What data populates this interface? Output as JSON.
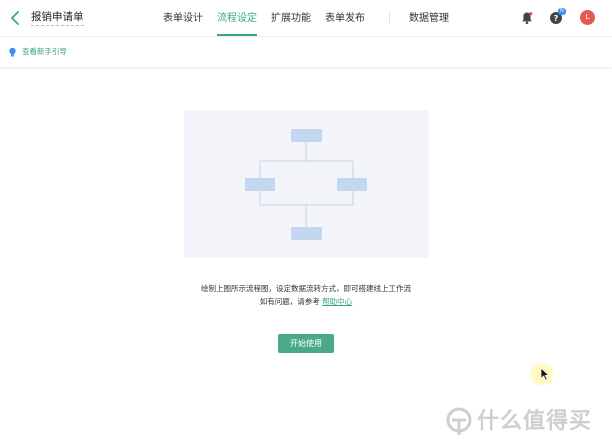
{
  "header": {
    "form_title": "报销申请单",
    "nav_tabs": [
      "表单设计",
      "流程设定",
      "扩展功能",
      "表单发布",
      "数据管理"
    ],
    "help_badge": "N",
    "avatar_initial": "L"
  },
  "subbar": {
    "guide_link": "查看新手引导"
  },
  "main": {
    "description_line1": "绘制上图所示流程图，设定数据流转方式，即可搭建线上工作流",
    "description_line2_prefix": "如有问题，请参考 ",
    "help_center_link": "帮助中心",
    "start_button": "开始使用"
  },
  "watermark": {
    "text": "什么值得买"
  },
  "colors": {
    "accent": "#3aa58a",
    "button": "#4aa88b",
    "diagram_node": "#c4d7f0",
    "avatar": "#e35a53"
  }
}
